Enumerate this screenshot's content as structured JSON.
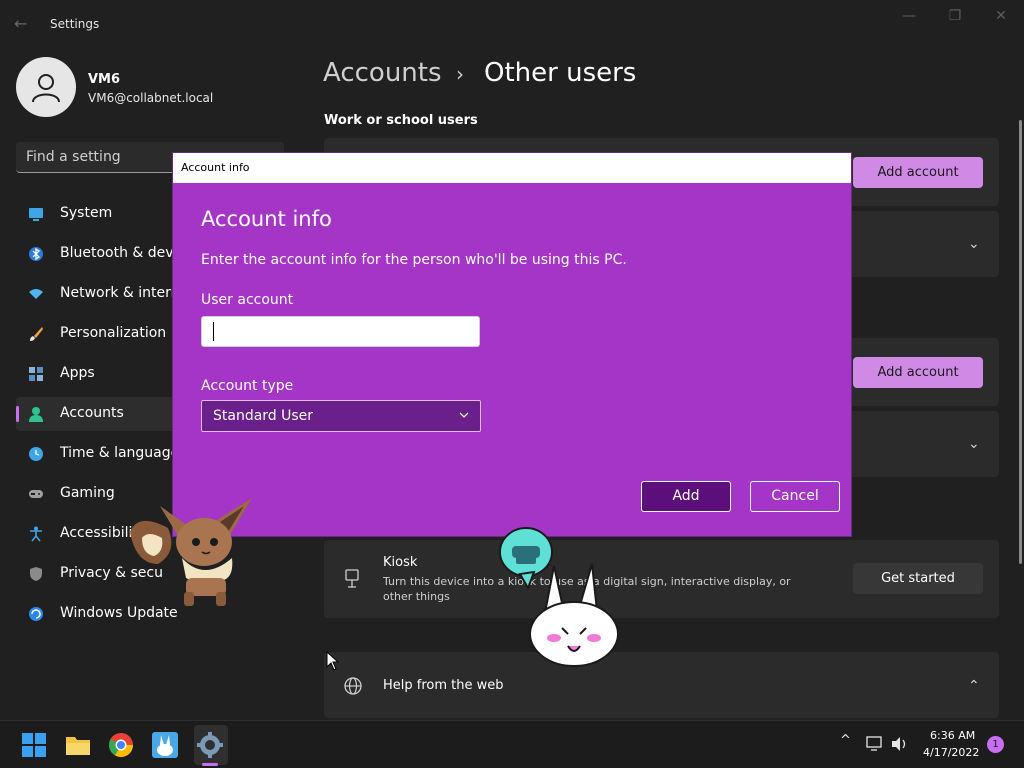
{
  "window": {
    "title": "Settings",
    "back_glyph": "←",
    "minimize_glyph": "—",
    "maximize_glyph": "❐",
    "close_glyph": "✕"
  },
  "profile": {
    "name": "VM6",
    "email": "VM6@collabnet.local"
  },
  "search": {
    "placeholder": "Find a setting"
  },
  "nav": {
    "items": [
      {
        "label": "System",
        "icon": "monitor-icon"
      },
      {
        "label": "Bluetooth & devic",
        "icon": "bluetooth-icon"
      },
      {
        "label": "Network & interne",
        "icon": "wifi-icon"
      },
      {
        "label": "Personalization",
        "icon": "brush-icon"
      },
      {
        "label": "Apps",
        "icon": "apps-icon"
      },
      {
        "label": "Accounts",
        "icon": "person-icon",
        "active": true
      },
      {
        "label": "Time & language",
        "icon": "clock-globe-icon"
      },
      {
        "label": "Gaming",
        "icon": "gamepad-icon"
      },
      {
        "label": "Accessibilit",
        "icon": "accessibility-icon"
      },
      {
        "label": "Privacy & secu",
        "icon": "shield-icon"
      },
      {
        "label": "Windows Update",
        "icon": "update-icon"
      }
    ]
  },
  "content": {
    "breadcrumb_root": "Accounts",
    "breadcrumb_sep": "›",
    "breadcrumb_current": "Other users",
    "section_work": "Work or school users",
    "add_account_label": "Add account",
    "kiosk": {
      "title": "Kiosk",
      "description": "Turn this device into a kiosk to use as a digital sign, interactive display, or other things",
      "button": "Get started"
    },
    "help": {
      "title": "Help from the web"
    }
  },
  "dialog": {
    "window_title": "Account info",
    "heading": "Account info",
    "description": "Enter the account info for the person who'll be using this PC.",
    "user_account_label": "User account",
    "user_account_value": "",
    "account_type_label": "Account type",
    "account_type_value": "Standard User",
    "add_label": "Add",
    "cancel_label": "Cancel"
  },
  "taskbar": {
    "time": "6:36 AM",
    "date": "4/17/2022",
    "notifications": "1",
    "tray_chevron": "^"
  },
  "colors": {
    "accent": "#c86ef5",
    "dialog_bg": "#a535c6",
    "accent_button": "#d08ae6"
  }
}
